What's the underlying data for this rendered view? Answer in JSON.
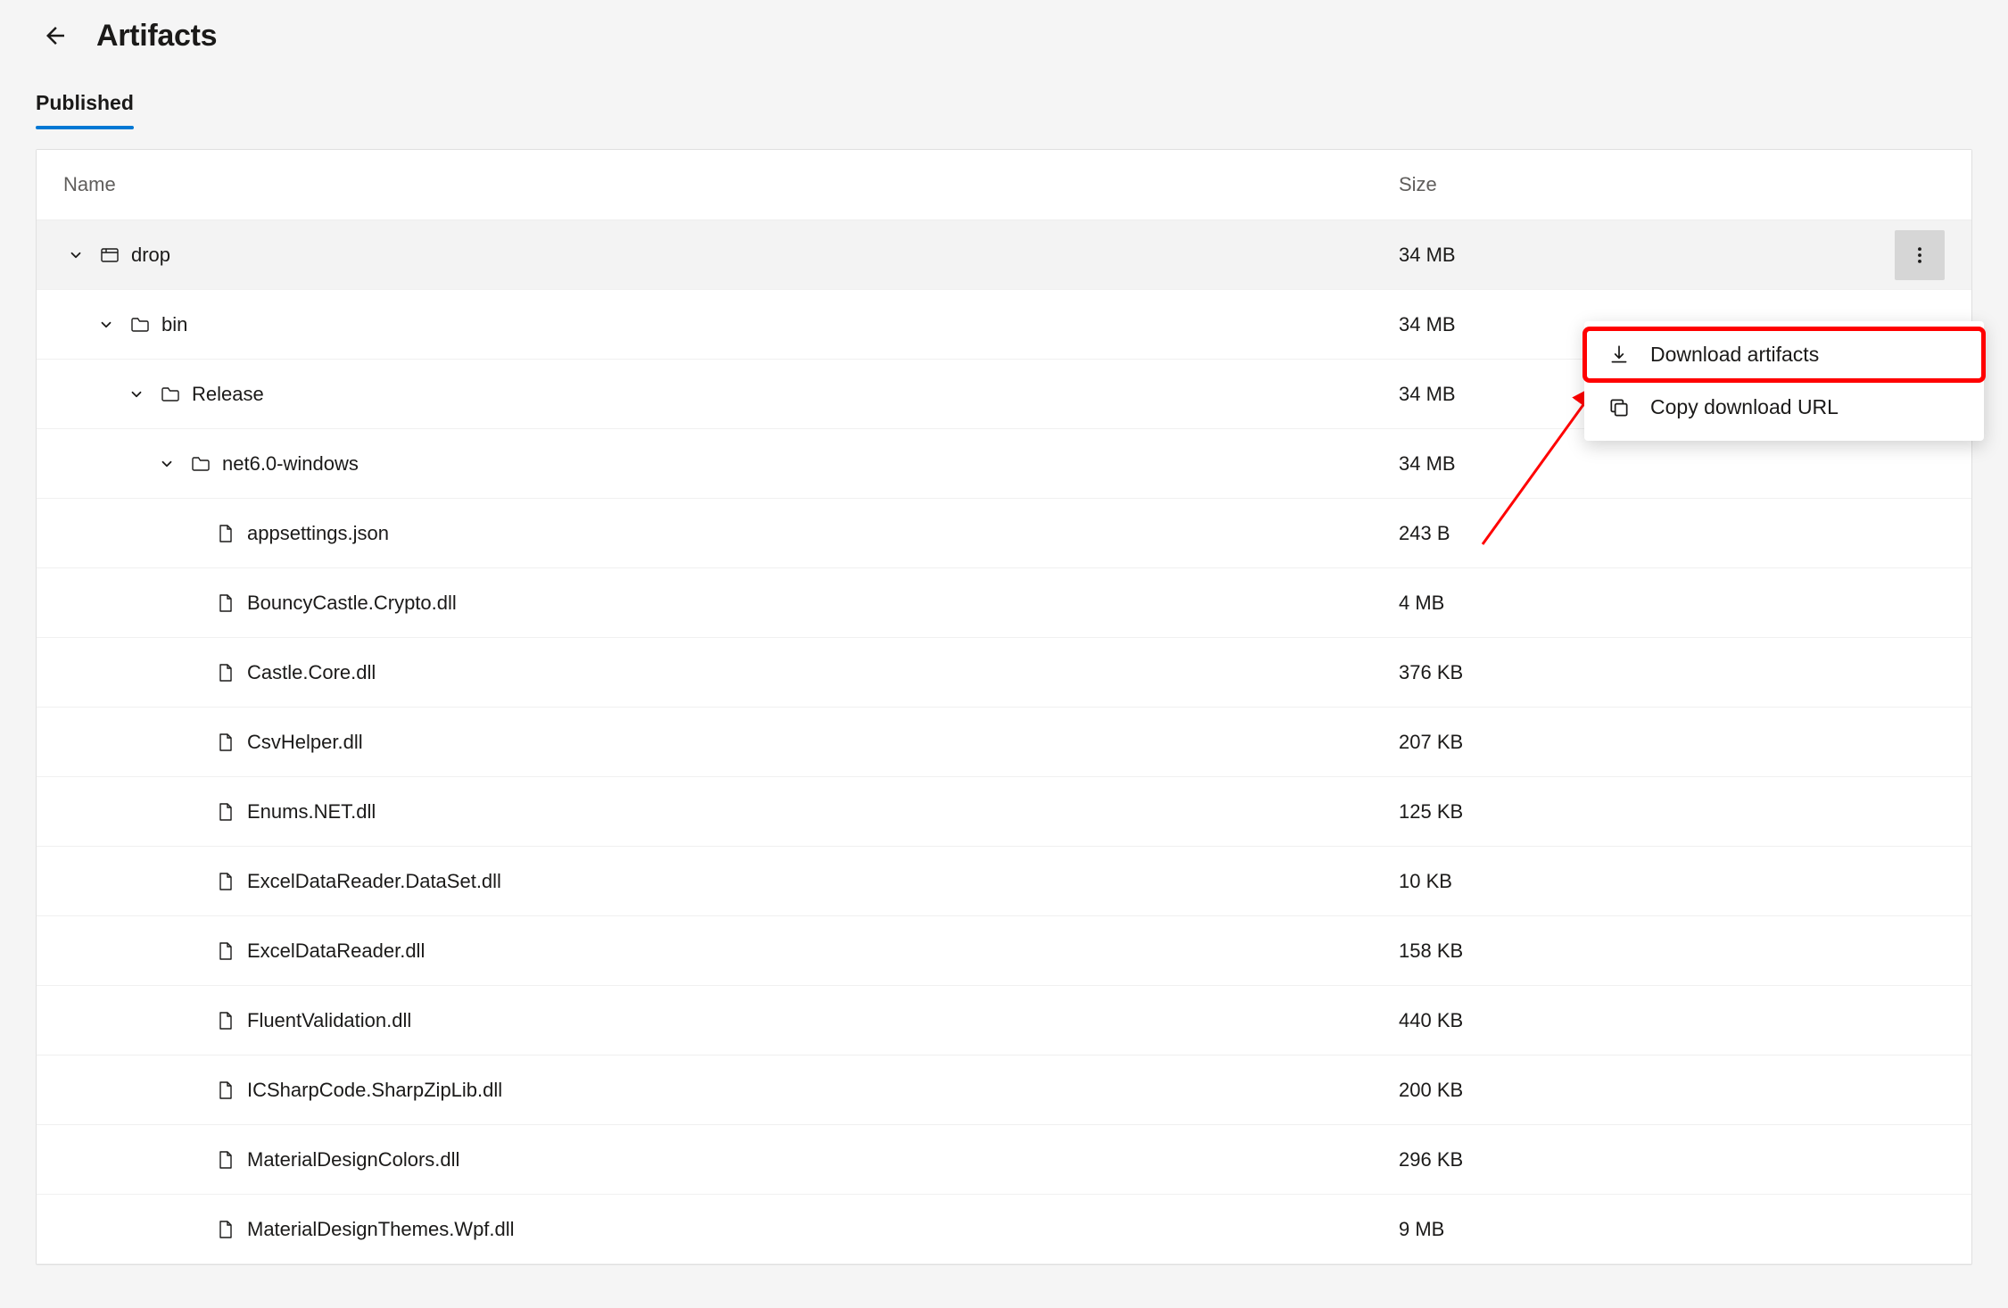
{
  "header": {
    "title": "Artifacts"
  },
  "tabs": {
    "published": "Published"
  },
  "columns": {
    "name": "Name",
    "size": "Size"
  },
  "rows": [
    {
      "indent": 0,
      "type": "artifact",
      "expanded": true,
      "name": "drop",
      "size": "34 MB",
      "selected": true,
      "showMore": true
    },
    {
      "indent": 1,
      "type": "folder",
      "expanded": true,
      "name": "bin",
      "size": "34 MB"
    },
    {
      "indent": 2,
      "type": "folder",
      "expanded": true,
      "name": "Release",
      "size": "34 MB"
    },
    {
      "indent": 3,
      "type": "folder",
      "expanded": true,
      "name": "net6.0-windows",
      "size": "34 MB"
    },
    {
      "indent": 4,
      "type": "file",
      "name": "appsettings.json",
      "size": "243 B"
    },
    {
      "indent": 4,
      "type": "file",
      "name": "BouncyCastle.Crypto.dll",
      "size": "4 MB"
    },
    {
      "indent": 4,
      "type": "file",
      "name": "Castle.Core.dll",
      "size": "376 KB"
    },
    {
      "indent": 4,
      "type": "file",
      "name": "CsvHelper.dll",
      "size": "207 KB"
    },
    {
      "indent": 4,
      "type": "file",
      "name": "Enums.NET.dll",
      "size": "125 KB"
    },
    {
      "indent": 4,
      "type": "file",
      "name": "ExcelDataReader.DataSet.dll",
      "size": "10 KB"
    },
    {
      "indent": 4,
      "type": "file",
      "name": "ExcelDataReader.dll",
      "size": "158 KB"
    },
    {
      "indent": 4,
      "type": "file",
      "name": "FluentValidation.dll",
      "size": "440 KB"
    },
    {
      "indent": 4,
      "type": "file",
      "name": "ICSharpCode.SharpZipLib.dll",
      "size": "200 KB"
    },
    {
      "indent": 4,
      "type": "file",
      "name": "MaterialDesignColors.dll",
      "size": "296 KB"
    },
    {
      "indent": 4,
      "type": "file",
      "name": "MaterialDesignThemes.Wpf.dll",
      "size": "9 MB"
    }
  ],
  "menu": {
    "download": "Download artifacts",
    "copyUrl": "Copy download URL"
  }
}
